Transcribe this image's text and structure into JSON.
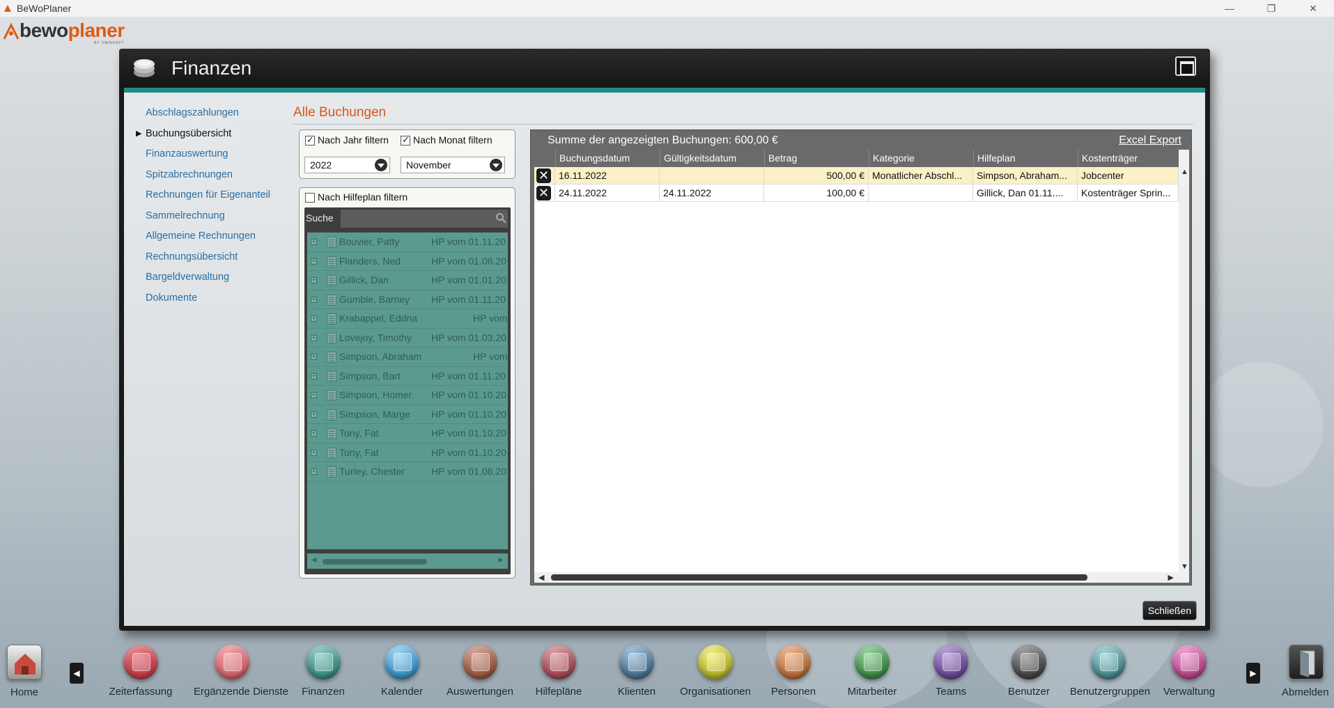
{
  "titlebar": {
    "title": "BeWoPlaner",
    "minimize": "—",
    "restore": "❐",
    "close": "✕"
  },
  "logo": {
    "part1": "bewo",
    "part2": "planer",
    "sub": "BY OWNSOFT"
  },
  "window": {
    "title": "Finanzen"
  },
  "nav": {
    "items": [
      {
        "label": "Abschlagszahlungen"
      },
      {
        "label": "Buchungsübersicht"
      },
      {
        "label": "Finanzauswertung"
      },
      {
        "label": "Spitzabrechnungen"
      },
      {
        "label": "Rechnungen für Eigenanteil"
      },
      {
        "label": "Sammelrechnung"
      },
      {
        "label": "Allgemeine Rechnungen"
      },
      {
        "label": "Rechnungsübersicht"
      },
      {
        "label": "Bargeldverwaltung"
      },
      {
        "label": "Dokumente"
      }
    ],
    "active_marker": "▶"
  },
  "section": {
    "title": "Alle Buchungen"
  },
  "filters": {
    "year_label": "Nach Jahr filtern",
    "month_label": "Nach Monat filtern",
    "year_value": "2022",
    "month_value": "November",
    "hp_label": "Nach Hilfeplan filtern"
  },
  "search": {
    "label": "Suche",
    "value": ""
  },
  "tree": {
    "items": [
      {
        "name": "Bouvier, Patty",
        "hp": "HP vom 01.11.20"
      },
      {
        "name": "Flanders, Ned",
        "hp": "HP vom 01.08.20"
      },
      {
        "name": "Gillick, Dan",
        "hp": "HP vom 01.01.20"
      },
      {
        "name": "Gumble, Barney",
        "hp": "HP vom 01.11.20"
      },
      {
        "name": "Krabappel, Eddna",
        "hp": "HP vom"
      },
      {
        "name": "Lovejoy, Timothy",
        "hp": "HP vom 01.03.20"
      },
      {
        "name": "Simpson, Abraham",
        "hp": "HP vom"
      },
      {
        "name": "Simpson, Bart",
        "hp": "HP vom 01.11.20"
      },
      {
        "name": "Simpson, Homer",
        "hp": "HP vom 01.10.20"
      },
      {
        "name": "Simpson, Marge",
        "hp": "HP vom 01.10.20"
      },
      {
        "name": "Tony, Fat",
        "hp": "HP vom 01.10.20"
      },
      {
        "name": "Tony, Fat",
        "hp": "HP vom 01.10.20"
      },
      {
        "name": "Turley, Chester",
        "hp": "HP vom 01.06.20"
      }
    ]
  },
  "grid": {
    "sum_label": "Summe der angezeigten Buchungen: 600,00 €",
    "export_label": "Excel Export",
    "columns": [
      "Buchungsdatum",
      "Gültigkeitsdatum",
      "Betrag",
      "Kategorie",
      "Hilfeplan",
      "Kostenträger"
    ],
    "rows": [
      {
        "buchungsdatum": "16.11.2022",
        "gueltigkeitsdatum": "",
        "betrag": "500,00 €",
        "kategorie": "Monatlicher Abschl...",
        "hilfeplan": "Simpson, Abraham...",
        "kostentraeger": "Jobcenter"
      },
      {
        "buchungsdatum": "24.11.2022",
        "gueltigkeitsdatum": "24.11.2022",
        "betrag": "100,00 €",
        "kategorie": "",
        "hilfeplan": "Gillick, Dan 01.11....",
        "kostentraeger": "Kostenträger Sprin..."
      }
    ],
    "delete_glyph": "✕"
  },
  "close_button": {
    "label": "Schließen"
  },
  "dock": {
    "home": "Home",
    "logout": "Abmelden",
    "items": [
      {
        "label": "Zeiterfassung",
        "color": "#c0404a"
      },
      {
        "label": "Ergänzende Dienste",
        "color": "#d0646c"
      },
      {
        "label": "Finanzen",
        "color": "#3d8f85"
      },
      {
        "label": "Kalender",
        "color": "#3c93c4"
      },
      {
        "label": "Auswertungen",
        "color": "#9a5a45"
      },
      {
        "label": "Hilfepläne",
        "color": "#a44d57"
      },
      {
        "label": "Klienten",
        "color": "#4c7494"
      },
      {
        "label": "Organisationen",
        "color": "#b8b52a"
      },
      {
        "label": "Personen",
        "color": "#b9703c"
      },
      {
        "label": "Mitarbeiter",
        "color": "#3f8c48"
      },
      {
        "label": "Teams",
        "color": "#6d4b97"
      },
      {
        "label": "Benutzer",
        "color": "#4a4a4a"
      },
      {
        "label": "Benutzergruppen",
        "color": "#4c8c92"
      },
      {
        "label": "Verwaltung",
        "color": "#b8488f"
      }
    ]
  }
}
